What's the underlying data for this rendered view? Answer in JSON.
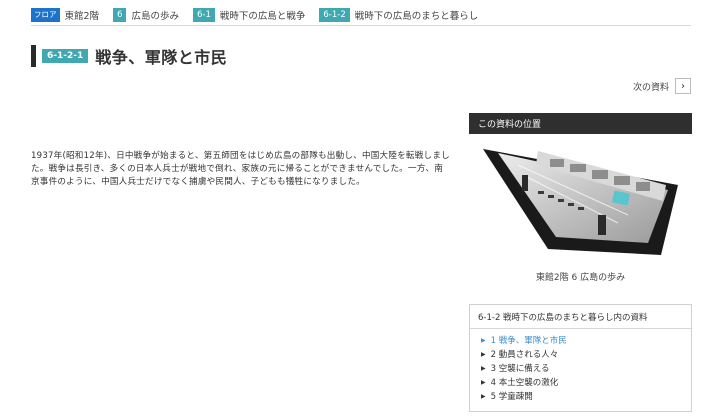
{
  "breadcrumb": {
    "floor_tag": "フロア",
    "floor_label": "東館2階",
    "zone_tag": "6",
    "zone_label": "広島の歩み",
    "section_tag": "6-1",
    "section_label": "戦時下の広島と戦争",
    "subsection_tag": "6-1-2",
    "subsection_label": "戦時下の広島のまちと暮らし"
  },
  "page": {
    "item_tag": "6-1-2-1",
    "title": "戦争、軍隊と市民",
    "next_label": "次の資料",
    "next_icon": "›",
    "body": "1937年(昭和12年)、日中戦争が始まると、第五師団をはじめ広島の部隊も出動し、中国大陸を転戦しました。戦争は長引き、多くの日本人兵士が戦地で倒れ、家族の元に帰ることができませんでした。一方、南京事件のように、中国人兵士だけでなく捕虜や民間人、子どもも犠牲になりました。"
  },
  "sidebar": {
    "location_heading": "この資料の位置",
    "map_caption": "東館2階 6 広島の歩み",
    "list_heading": "6-1-2 戦時下の広島のまちと暮らし内の資料",
    "items": [
      {
        "label": "1 戦争、軍隊と市民",
        "active": true
      },
      {
        "label": "2 動員される人々",
        "active": false
      },
      {
        "label": "3 空襲に備える",
        "active": false
      },
      {
        "label": "4 本土空襲の激化",
        "active": false
      },
      {
        "label": "5 学童疎開",
        "active": false
      }
    ]
  },
  "colors": {
    "tag_teal": "#3fa8b0",
    "tag_blue": "#1d73c9",
    "active_link": "#3b8fd0",
    "side_header": "#2f2f2f"
  }
}
